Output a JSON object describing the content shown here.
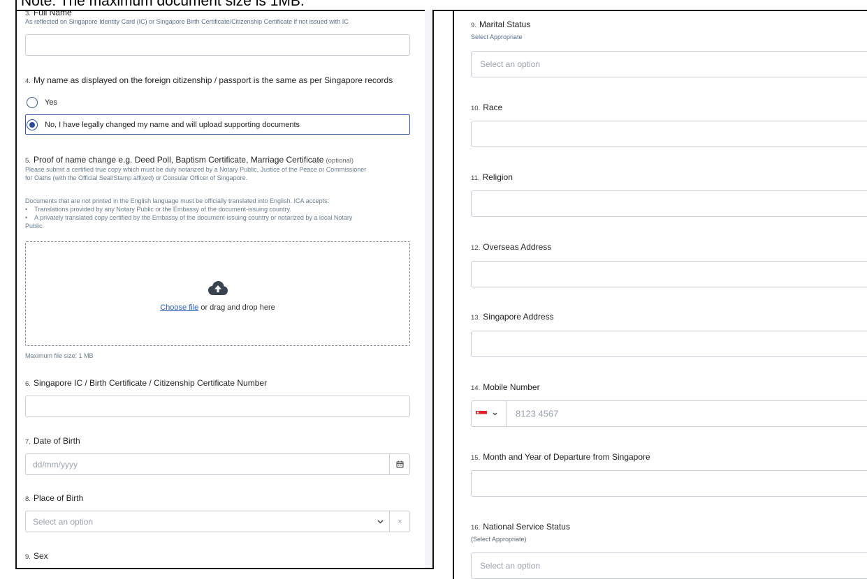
{
  "note": "Note: The maximum document size is 1MB.",
  "left": {
    "q3": {
      "num": "3.",
      "label": "Full Name",
      "helper": "As reflected on Singapore Identity Card (IC) or Singapore Birth Certificate/Citizenship Certificate if not issued with IC"
    },
    "q4": {
      "num": "4.",
      "label": "My name as displayed on the foreign citizenship / passport is the same as per Singapore records",
      "options": [
        "Yes",
        "No, I have legally changed my name and will upload supporting documents"
      ],
      "selected": "No, I have legally changed my name and will upload supporting documents"
    },
    "q5": {
      "num": "5.",
      "label": "Proof of name change e.g. Deed Poll, Baptism Certificate, Marriage Certificate",
      "optional": "(optional)",
      "helper1": "Please submit a certified true copy which must be duly notarized by a Notary Public, Justice of the Peace or Commissioner",
      "helper2": "for Oaths (with the Official Seal/Stamp affixed) or Consular Officer of Singapore.",
      "helper3": "Documents that are not printed in the English language must be officially translated into English. ICA accepts:",
      "bullet1": "Translations provided by any Notary Public or the Embassy of the document-issuing country.",
      "bullet2a": "A privately translated copy certified by the Embassy of the document-issuing country or notarized by a local Notary",
      "bullet2b": "Public.",
      "choose_file": "Choose file",
      "drop_text": " or drag and drop here",
      "max_size": "Maximum file size: 1 MB"
    },
    "q6": {
      "num": "6.",
      "label": "Singapore IC / Birth Certificate / Citizenship Certificate Number"
    },
    "q7": {
      "num": "7.",
      "label": "Date of Birth",
      "placeholder": "dd/mm/yyyy"
    },
    "q8": {
      "num": "8.",
      "label": "Place of Birth",
      "placeholder": "Select an option",
      "clear": "×"
    },
    "q9": {
      "num": "9.",
      "label": "Sex"
    }
  },
  "right": {
    "q9": {
      "num": "9.",
      "label": "Marital Status",
      "helper": "Select Appropriate",
      "placeholder": "Select an option"
    },
    "q10": {
      "num": "10.",
      "label": "Race"
    },
    "q11": {
      "num": "11.",
      "label": "Religion"
    },
    "q12": {
      "num": "12.",
      "label": "Overseas Address"
    },
    "q13": {
      "num": "13.",
      "label": "Singapore Address"
    },
    "q14": {
      "num": "14.",
      "label": "Mobile Number",
      "placeholder": "8123 4567"
    },
    "q15": {
      "num": "15.",
      "label": "Month and Year of Departure from Singapore"
    },
    "q16": {
      "num": "16.",
      "label": "National Service Status",
      "helper": "(Select Appropriate)",
      "placeholder": "Select an option"
    }
  },
  "colors": {
    "radio_accent": "#2b4a9e",
    "link": "#2c5cb9",
    "border": "#c9ced6",
    "flag_red": "#e0242b"
  }
}
